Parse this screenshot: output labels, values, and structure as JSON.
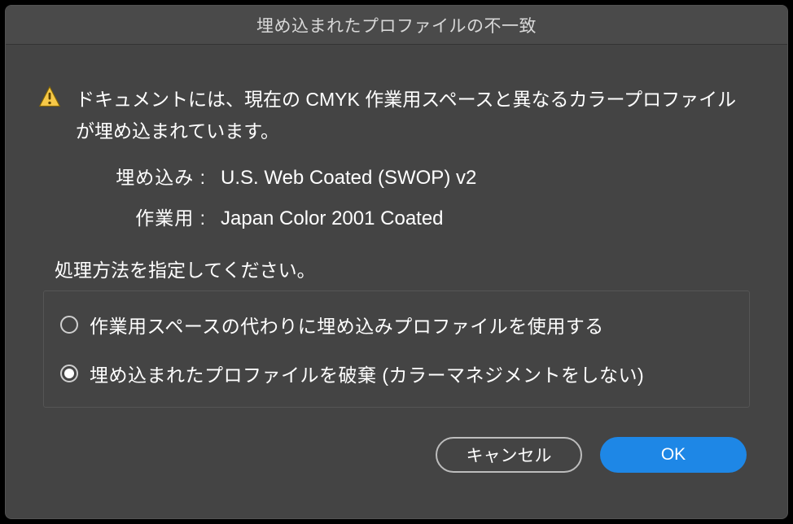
{
  "title": "埋め込まれたプロファイルの不一致",
  "message": "ドキュメントには、現在の CMYK 作業用スペースと異なるカラープロファイルが埋め込まれています。",
  "embedded": {
    "label": "埋め込み :",
    "value": "U.S. Web Coated (SWOP) v2"
  },
  "working": {
    "label": "作業用 :",
    "value": "Japan Color 2001 Coated"
  },
  "instruction": "処理方法を指定してください。",
  "options": {
    "use_embedded": "作業用スペースの代わりに埋め込みプロファイルを使用する",
    "discard": "埋め込まれたプロファイルを破棄 (カラーマネジメントをしない)"
  },
  "buttons": {
    "cancel": "キャンセル",
    "ok": "OK"
  },
  "icon": "warning-icon",
  "selected_option": "discard"
}
